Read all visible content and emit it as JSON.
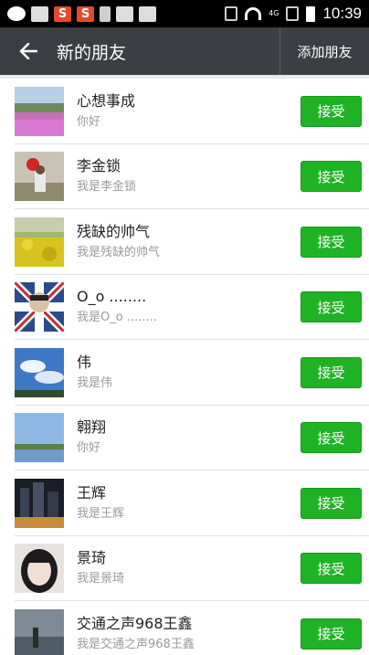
{
  "status_bar": {
    "time": "10:39",
    "network_label": "4G",
    "icons": [
      "wechat-icon",
      "image-icon",
      "sogou-icon",
      "sogou-icon",
      "trash-icon",
      "image-icon",
      "gallery-icon",
      "nfc-icon",
      "wifi-icon",
      "signal-icon",
      "battery-icon"
    ]
  },
  "header": {
    "title": "新的朋友",
    "back_icon": "back-arrow-icon",
    "add_friend_label": "添加朋友"
  },
  "accent_color": "#1fb225",
  "requests": [
    {
      "name": "心想事成",
      "message": "你好",
      "accept_label": "接受"
    },
    {
      "name": "李金锁",
      "message": "我是李金锁",
      "accept_label": "接受"
    },
    {
      "name": "残缺的帅气",
      "message": "我是残缺的帅气",
      "accept_label": "接受"
    },
    {
      "name": "O_o  ........",
      "message": "我是O_o  ........",
      "accept_label": "接受"
    },
    {
      "name": "伟",
      "message": "我是伟",
      "accept_label": "接受"
    },
    {
      "name": "翱翔",
      "message": "你好",
      "accept_label": "接受"
    },
    {
      "name": "王辉",
      "message": "我是王辉",
      "accept_label": "接受"
    },
    {
      "name": "景琦",
      "message": "我是景琦",
      "accept_label": "接受"
    },
    {
      "name": "交通之声968王鑫",
      "message": "我是交通之声968王鑫",
      "accept_label": "接受"
    }
  ]
}
